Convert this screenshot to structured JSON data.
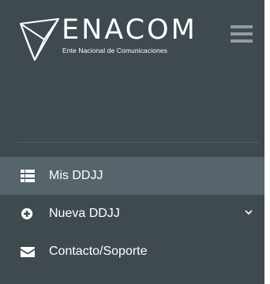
{
  "brand": {
    "name": "ENACOM",
    "subtitle": "Ente Nacional de Comunicaciones",
    "logo_icon": "enacom-logo-icon"
  },
  "header": {
    "menu_icon": "hamburger-menu-icon"
  },
  "nav": {
    "items": [
      {
        "label": "Mis DDJJ",
        "icon": "list-icon",
        "active": true
      },
      {
        "label": "Nueva DDJJ",
        "icon": "plus-circle-icon",
        "has_submenu": true,
        "submenu_icon": "chevron-down-icon"
      },
      {
        "label": "Contacto/Soporte",
        "icon": "envelope-icon"
      }
    ]
  },
  "colors": {
    "sidebar_bg": "#3e4a4f",
    "active_item_bg": "#56656c",
    "text": "#ffffff",
    "hamburger": "#929b9f",
    "divider": "#53605f"
  }
}
